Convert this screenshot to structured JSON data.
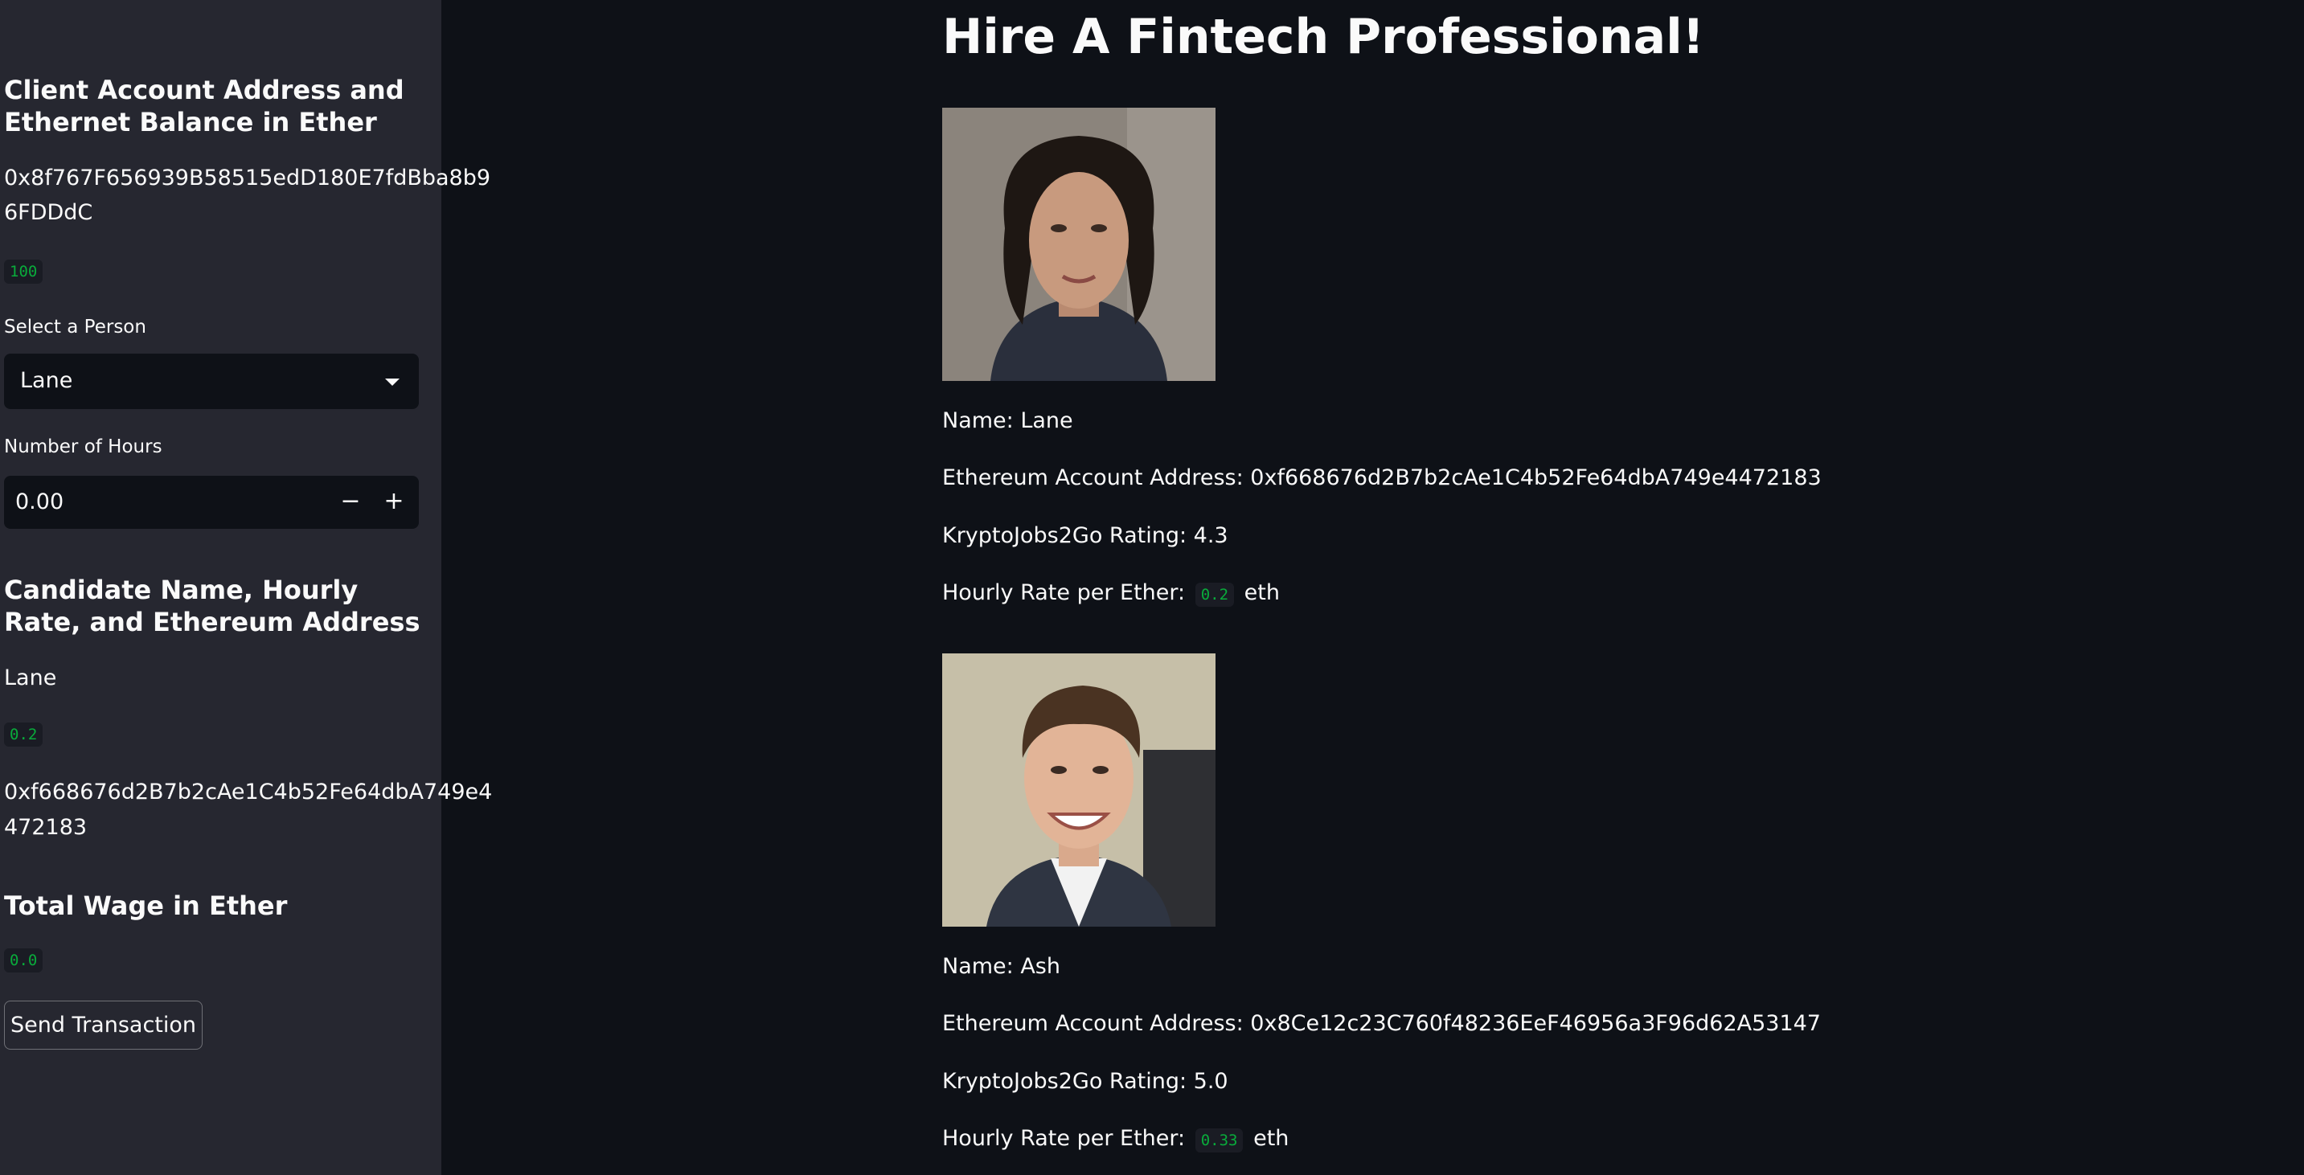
{
  "sidebar": {
    "client_heading": "Client Account Address and Ethernet Balance in Ether",
    "client_address_line1": "0x8f767F656939B58515edD180E7fdBba8b9",
    "client_address_line2": "6FDDdC",
    "client_balance": "100",
    "select_label": "Select a Person",
    "select_value": "Lane",
    "hours_label": "Number of Hours",
    "hours_value": "0.00",
    "hours_minus": "−",
    "hours_plus": "+",
    "candidate_heading": "Candidate Name, Hourly Rate, and Ethereum Address",
    "candidate_name": "Lane",
    "candidate_rate": "0.2",
    "candidate_address_line1": "0xf668676d2B7b2cAe1C4b52Fe64dbA749e4",
    "candidate_address_line2": "472183",
    "wage_heading": "Total Wage in Ether",
    "wage_value": "0.0",
    "send_button": "Send Transaction"
  },
  "main": {
    "title": "Hire A Fintech Professional!",
    "candidates": [
      {
        "name_text": "Name: Lane",
        "address_text": "Ethereum Account Address: 0xf668676d2B7b2cAe1C4b52Fe64dbA749e4472183",
        "rating_text": "KryptoJobs2Go Rating: 4.3",
        "rate_prefix": "Hourly Rate per Ether:",
        "rate_value": "0.2",
        "rate_unit": "eth"
      },
      {
        "name_text": "Name: Ash",
        "address_text": "Ethereum Account Address: 0x8Ce12c23C760f48236EeF46956a3F96d62A53147",
        "rating_text": "KryptoJobs2Go Rating: 5.0",
        "rate_prefix": "Hourly Rate per Ether:",
        "rate_value": "0.33",
        "rate_unit": "eth"
      }
    ]
  },
  "colors": {
    "app_background": "#0e1117",
    "sidebar_background": "#262730",
    "code_text": "#09ab3b",
    "text": "#fafafa"
  }
}
